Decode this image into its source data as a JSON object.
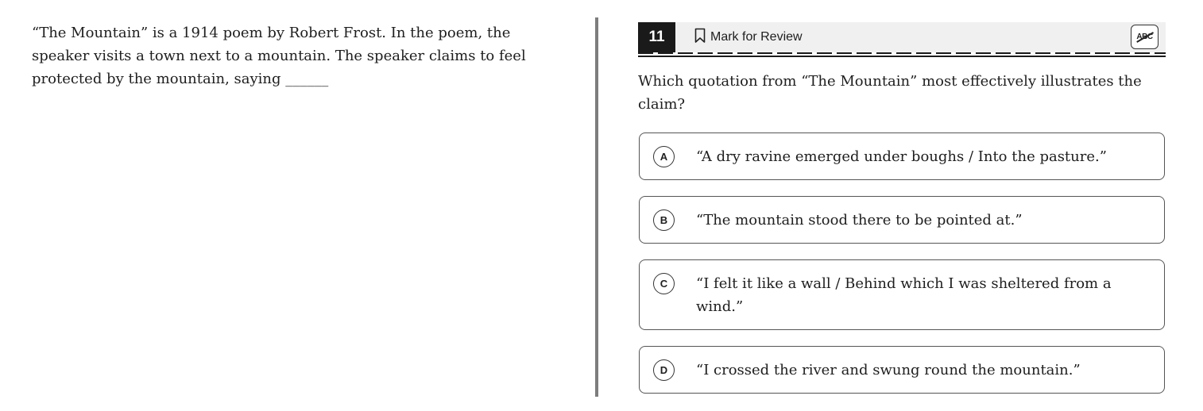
{
  "passage": {
    "text": "“The Mountain” is a 1914 poem by Robert Frost. In the poem, the speaker visits a town next to a mountain. The speaker claims to feel protected by the mountain, saying ______"
  },
  "question_header": {
    "number": "11",
    "mark_for_review_label": "Mark for Review",
    "icons": {
      "bookmark": "bookmark-icon",
      "abc_strike": "abc-strikethrough-icon"
    },
    "abc_label": "ABC"
  },
  "question": {
    "text": "Which quotation from “The Mountain” most effectively illustrates the claim?"
  },
  "choices": [
    {
      "letter": "A",
      "text": "“A dry ravine emerged under boughs / Into the pasture.”"
    },
    {
      "letter": "B",
      "text": "“The mountain stood there to be pointed at.”"
    },
    {
      "letter": "C",
      "text": "“I felt it like a wall / Behind which I was sheltered from a wind.”"
    },
    {
      "letter": "D",
      "text": "“I crossed the river and swung round the mountain.”"
    }
  ],
  "colors": {
    "question_number_bg": "#1a1a1a",
    "header_bg": "#f0f0f0",
    "divider": "#7d7d7d"
  }
}
